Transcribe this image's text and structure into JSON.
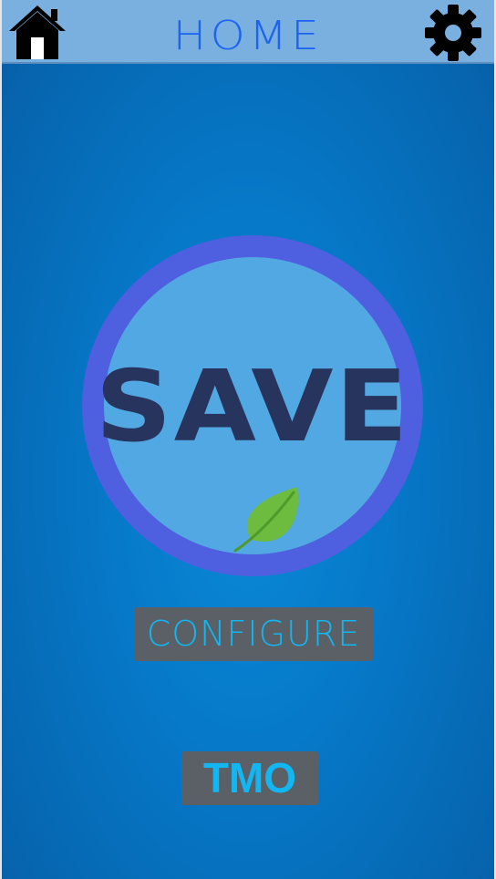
{
  "header": {
    "title": "HOME",
    "home_icon": "home-icon",
    "settings_icon": "gear-icon"
  },
  "main": {
    "save_label": "SAVE",
    "leaf_icon": "leaf-icon",
    "configure_label": "CONFIGURE",
    "tmo_label": "TMO"
  },
  "colors": {
    "background": "#0679c8",
    "header_bg": "#7ab0df",
    "title": "#1d63f0",
    "ring": "#4e5fe0",
    "circle_fill": "#52a8e3",
    "save_text": "#27345e",
    "leaf": "#6dbb3f",
    "button_bg": "#5b5f66",
    "button_text": "#12b6f2"
  }
}
